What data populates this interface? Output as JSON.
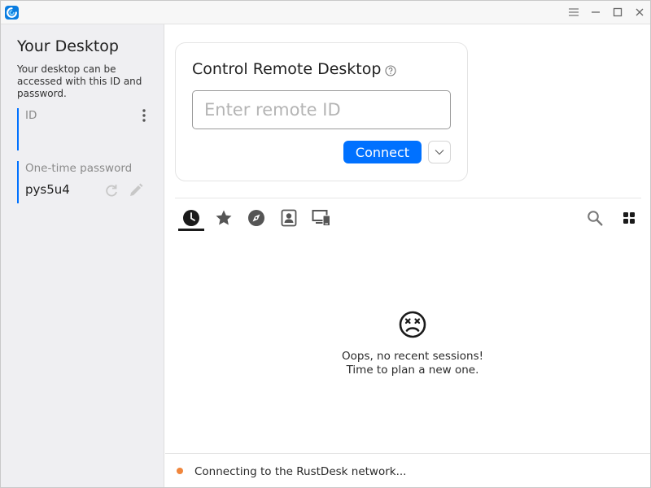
{
  "titlebar": {
    "logo_icon": "rustdesk-logo-icon",
    "menu_icon": "hamburger-menu-icon",
    "minimize_icon": "minimize-icon",
    "maximize_icon": "maximize-icon",
    "close_icon": "close-icon"
  },
  "sidebar": {
    "title": "Your Desktop",
    "description": "Your desktop can be accessed with this ID and password.",
    "id_field": {
      "label": "ID",
      "value": ""
    },
    "password_field": {
      "label": "One-time password",
      "value": "pys5u4"
    }
  },
  "control": {
    "title": "Control Remote Desktop",
    "input_placeholder": "Enter remote ID",
    "input_value": "",
    "connect_label": "Connect"
  },
  "tabs": [
    {
      "icon": "recent-sessions-clock-icon",
      "active": true
    },
    {
      "icon": "favorites-star-icon",
      "active": false
    },
    {
      "icon": "discovered-compass-icon",
      "active": false
    },
    {
      "icon": "address-book-icon",
      "active": false
    },
    {
      "icon": "group-devices-icon",
      "active": false
    }
  ],
  "empty_state": {
    "icon": "dizzy-face-icon",
    "line1": "Oops, no recent sessions!",
    "line2": "Time to plan a new one."
  },
  "status": {
    "text": "Connecting to the RustDesk network...",
    "color": "#f0863c"
  },
  "colors": {
    "accent": "#0071ff"
  }
}
